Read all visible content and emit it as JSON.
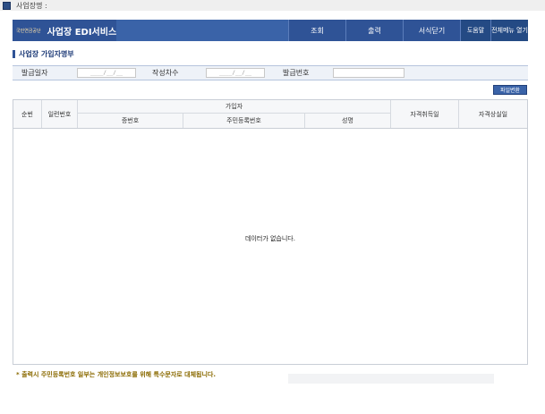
{
  "topbar": {
    "title": "사업장명 :"
  },
  "header": {
    "logo_text": "국민연금공단",
    "brand": "사업장 EDI서비스",
    "menu": {
      "inquiry": "조회",
      "print": "출력",
      "close": "서식닫기",
      "help": "도움말",
      "all_menu": "전체메뉴 열기"
    }
  },
  "section": {
    "title": "사업장 가입자명부"
  },
  "filters": {
    "issue_date_label": "발급일자",
    "issue_date_value": "____/__/__",
    "round_label": "작성차수",
    "round_value": "____/__/__",
    "issue_no_label": "발급번호",
    "issue_no_value": ""
  },
  "buttons": {
    "convert": "파일변환"
  },
  "table": {
    "columns": {
      "seq": "순번",
      "serial": "일련번호",
      "subscriber": "가입자",
      "cert_no": "증번호",
      "rrn": "주민등록번호",
      "name": "성명",
      "acquired": "자격취득일",
      "lost": "자격상실일"
    },
    "rows": [],
    "empty_message": "데이터가 없습니다."
  },
  "notice": "* 출력시 주민등록번호 일부는 개인정보보호를 위해 특수문자로 대체됩니다."
}
